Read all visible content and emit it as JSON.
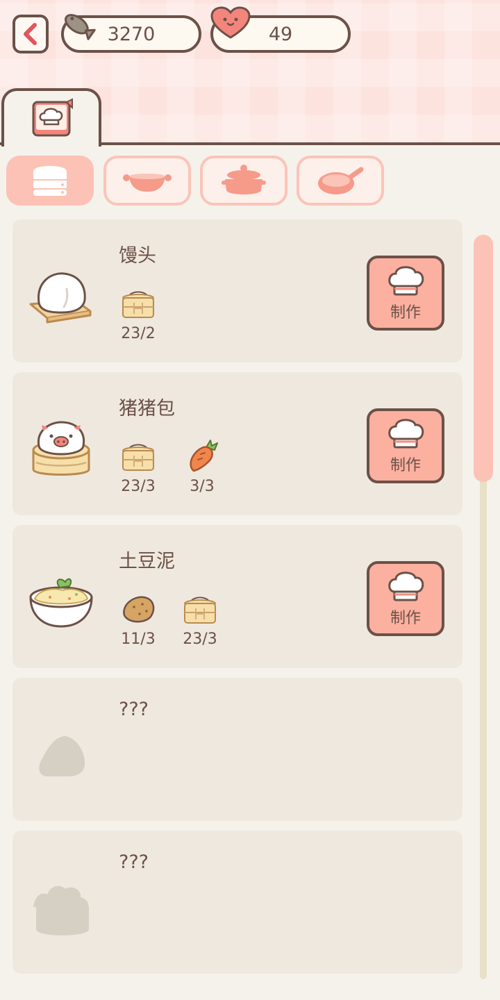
{
  "header": {
    "fish_count": "3270",
    "heart_count": "49"
  },
  "tabs": {
    "recipe_book_icon": "recipe-book-icon",
    "categories": [
      {
        "icon": "steamer-icon",
        "active": true
      },
      {
        "icon": "wok-icon",
        "active": false
      },
      {
        "icon": "pot-icon",
        "active": false
      },
      {
        "icon": "frying-pan-icon",
        "active": false
      }
    ]
  },
  "recipes": [
    {
      "name": "馒头",
      "icon": "mantou-icon",
      "ingredients": [
        {
          "icon": "flour-steamer-icon",
          "count": "23/2"
        }
      ],
      "button_label": "制作"
    },
    {
      "name": "猪猪包",
      "icon": "pig-bun-icon",
      "ingredients": [
        {
          "icon": "flour-steamer-icon",
          "count": "23/3"
        },
        {
          "icon": "carrot-icon",
          "count": "3/3"
        }
      ],
      "button_label": "制作"
    },
    {
      "name": "土豆泥",
      "icon": "mashed-potato-icon",
      "ingredients": [
        {
          "icon": "potato-icon",
          "count": "11/3"
        },
        {
          "icon": "flour-steamer-icon",
          "count": "23/3"
        }
      ],
      "button_label": "制作"
    },
    {
      "name": "???",
      "icon": "locked-dish-icon"
    },
    {
      "name": "???",
      "icon": "locked-dish-icon"
    }
  ],
  "colors": {
    "accent": "#fbb0a0",
    "outline": "#6b5148",
    "card": "#efe8de",
    "background": "#f5f2ec"
  }
}
